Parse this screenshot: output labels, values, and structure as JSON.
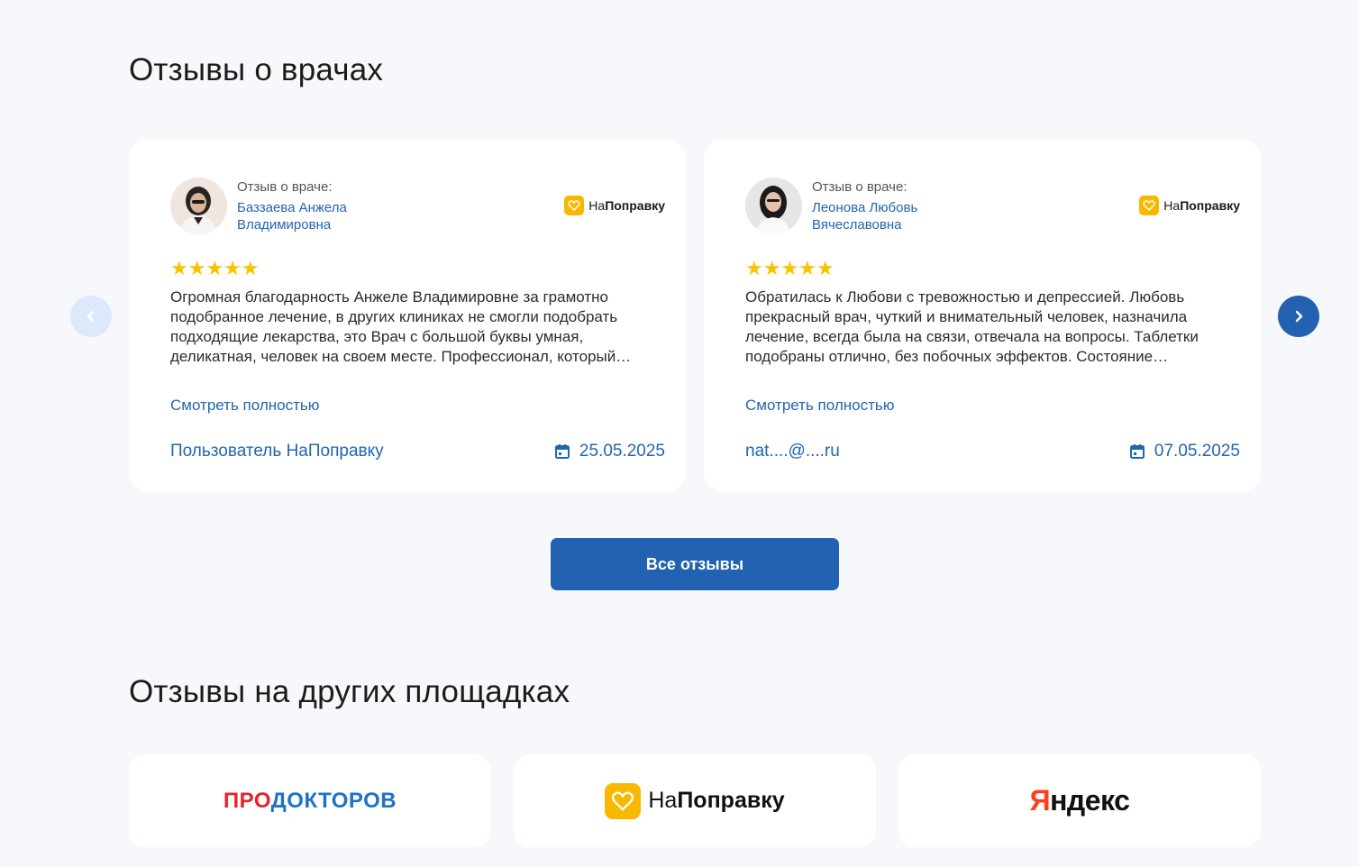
{
  "reviews_section": {
    "title": "Отзывы о врачах"
  },
  "reviews": [
    {
      "caption": "Отзыв о враче:",
      "doctor_name": "Баззаева Анжела Владимировна",
      "source_prefix": "На",
      "source_bold": "Поправку",
      "rating": 5,
      "stars": "★★★★★",
      "text": "Огромная благодарность Анжеле Владимировне за грамотно подобранное лечение, в других клиниках не смогли подобрать подходящие лекарства, это Врач с большой буквы умная, деликатная, человек на своем месте. Профессионал, который…",
      "more_label": "Смотреть полностью",
      "author": "Пользователь НаПоправку",
      "date": "25.05.2025"
    },
    {
      "caption": "Отзыв о враче:",
      "doctor_name": "Леонова Любовь Вячеславовна",
      "source_prefix": "На",
      "source_bold": "Поправку",
      "rating": 5,
      "stars": "★★★★★",
      "text": "Обратилась к Любови с тревожностью и депрессией. Любовь прекрасный врач, чуткий и внимательный человек, назначила лечение, всегда была на связи, отвечала на вопросы. Таблетки подобраны отлично, без побочных эффектов. Состояние…",
      "more_label": "Смотреть полностью",
      "author": "nat....@....ru",
      "date": "07.05.2025"
    }
  ],
  "all_reviews_button": "Все отзывы",
  "other_section": {
    "title": "Отзывы на других площадках"
  },
  "platforms": {
    "prodoctorov": {
      "part1": "ПРО",
      "part2": "ДОКТОРОВ"
    },
    "napopravku": {
      "prefix": "На",
      "bold": "Поправку"
    },
    "yandex": {
      "first": "Я",
      "rest": "ндекс"
    }
  },
  "colors": {
    "accent": "#2262b0",
    "link": "#2266b0",
    "star": "#f5c400",
    "napopravku_brand": "#f9b800",
    "prodoctorov_red": "#e5232e",
    "prodoctorov_blue": "#1e73c8",
    "yandex_red": "#fc3f1d"
  },
  "icons": {
    "prev": "chevron-left-icon",
    "next": "chevron-right-icon",
    "date": "calendar-icon"
  }
}
